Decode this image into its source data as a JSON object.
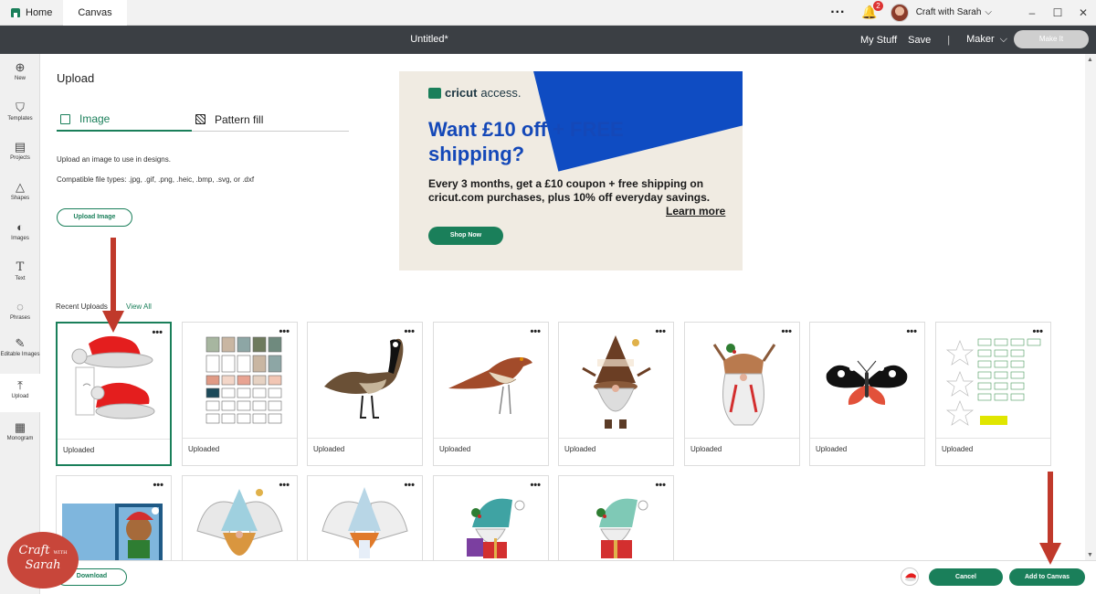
{
  "titlebar": {
    "home_label": "Home",
    "canvas_tab_label": "Canvas",
    "notification_count": "2",
    "user_name": "Craft with Sarah",
    "minimize": "–",
    "maximize": "☐",
    "close": "✕"
  },
  "header": {
    "doc_title": "Untitled*",
    "my_stuff": "My Stuff",
    "save": "Save",
    "separator": "|",
    "machine": "Maker",
    "make_it": "Make It"
  },
  "rail": [
    {
      "label": "New",
      "icon": "⊕"
    },
    {
      "label": "Templates",
      "icon": "👕"
    },
    {
      "label": "Projects",
      "icon": "▤"
    },
    {
      "label": "Shapes",
      "icon": "△"
    },
    {
      "label": "Images",
      "icon": "💡"
    },
    {
      "label": "Text",
      "icon": "T"
    },
    {
      "label": "Phrases",
      "icon": "💬"
    },
    {
      "label": "Editable Images",
      "icon": "✎"
    },
    {
      "label": "Upload",
      "icon": "⤒"
    },
    {
      "label": "Monogram",
      "icon": "▦"
    }
  ],
  "panel": {
    "title": "Upload",
    "tabs": [
      {
        "label": "Image",
        "selected": true
      },
      {
        "label": "Pattern fill",
        "selected": false
      }
    ],
    "description": "Upload an image to use in designs.",
    "file_types": "Compatible file types: .jpg, .gif, .png, .heic, .bmp, .svg, or .dxf",
    "upload_button": "Upload Image"
  },
  "ad": {
    "brand": "cricut",
    "brand_suffix": "access.",
    "headline": "Want £10 off + FREE shipping?",
    "body": "Every 3 months, get a £10 coupon + free shipping on cricut.com purchases, plus 10% off everyday savings.",
    "learn_more": "Learn more",
    "cta": "Shop Now"
  },
  "recent": {
    "label": "Recent Uploads",
    "view_all": "View All",
    "menu_glyph": "•••",
    "items": [
      {
        "caption": "Uploaded",
        "subject": "santa-hats",
        "selected": true
      },
      {
        "caption": "Uploaded",
        "subject": "pattern-labels"
      },
      {
        "caption": "Uploaded",
        "subject": "goose"
      },
      {
        "caption": "Uploaded",
        "subject": "thrasher-bird"
      },
      {
        "caption": "Uploaded",
        "subject": "reindeer-gnome-brown"
      },
      {
        "caption": "Uploaded",
        "subject": "reindeer-gnome-girl"
      },
      {
        "caption": "Uploaded",
        "subject": "tiger-moth"
      },
      {
        "caption": "Uploaded",
        "subject": "star-stencil-sheet"
      },
      {
        "caption": "",
        "subject": "christmas-bear-card"
      },
      {
        "caption": "",
        "subject": "angel-gnome-blonde"
      },
      {
        "caption": "",
        "subject": "angel-gnome-red"
      },
      {
        "caption": "",
        "subject": "gnome-presents"
      },
      {
        "caption": "",
        "subject": "gnome-holly-present"
      }
    ]
  },
  "footer": {
    "download": "Download",
    "cancel": "Cancel",
    "add_to_canvas": "Add to Canvas"
  },
  "watermark": {
    "line1": "Craft",
    "small": "WITH",
    "line2": "Sarah"
  },
  "colors": {
    "accent": "#1a7f5a",
    "header_bg": "#3b3f44",
    "annotation_arrow": "#c0392b",
    "ad_blue": "#1448b8"
  }
}
